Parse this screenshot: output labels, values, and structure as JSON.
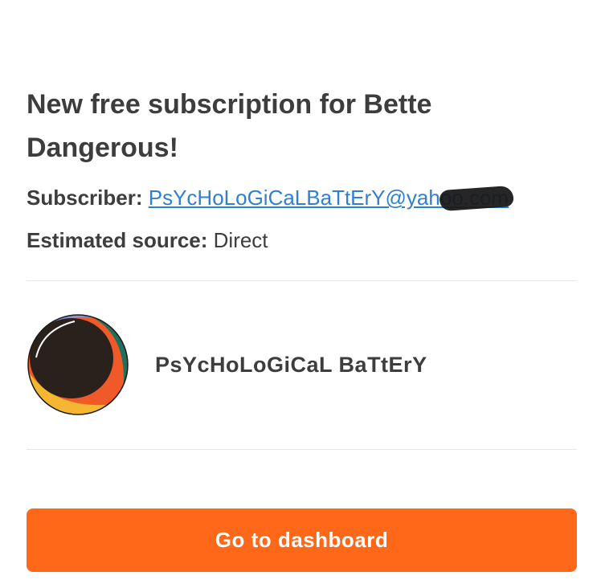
{
  "email": {
    "title": "New free subscription for Bette Dangerous!",
    "subscriber_label": "Subscriber:",
    "subscriber_email": "PsYcHoLoGiCaLBaTtErY@yahoo.com",
    "source_label": "Estimated source:",
    "source_value": "Direct"
  },
  "publication": {
    "name": "PsYcHoLoGiCaL BaTtErY",
    "avatar_icon": "eclipse-circle-avatar"
  },
  "actions": {
    "dashboard_label": "Go to dashboard"
  },
  "colors": {
    "accent": "#ff6719",
    "link": "#2f7fd3",
    "text": "#3d3d3d",
    "divider": "#e8e6e3"
  }
}
